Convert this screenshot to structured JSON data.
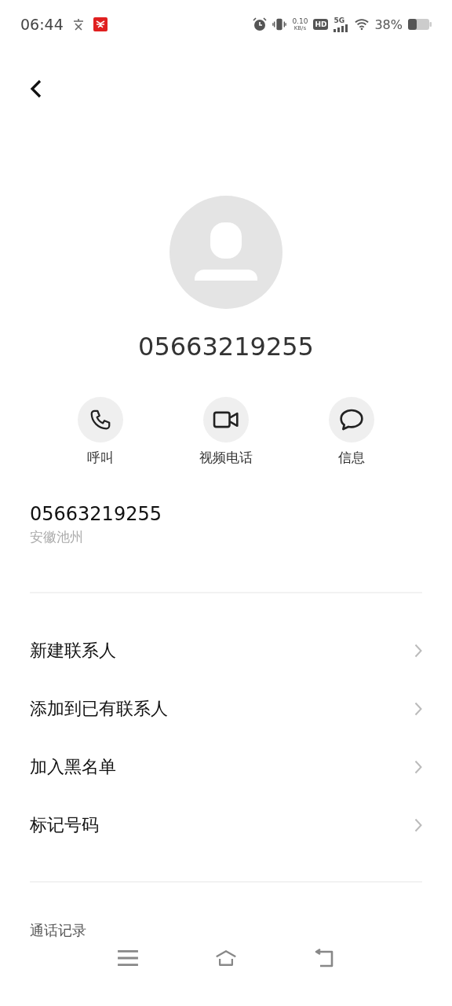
{
  "status_bar": {
    "time": "06:44",
    "net_speed": "0.10",
    "net_speed_unit": "KB/s",
    "hd_badge": "HD",
    "network": "5G",
    "battery": "38%"
  },
  "contact": {
    "name": "05663219255"
  },
  "actions": [
    {
      "kind": "call",
      "label": "呼叫"
    },
    {
      "kind": "video",
      "label": "视频电话"
    },
    {
      "kind": "message",
      "label": "信息"
    }
  ],
  "number_info": {
    "number": "05663219255",
    "location": "安徽池州"
  },
  "menu": [
    "新建联系人",
    "添加到已有联系人",
    "加入黑名单",
    "标记号码"
  ],
  "call_log": {
    "title": "通话记录"
  }
}
